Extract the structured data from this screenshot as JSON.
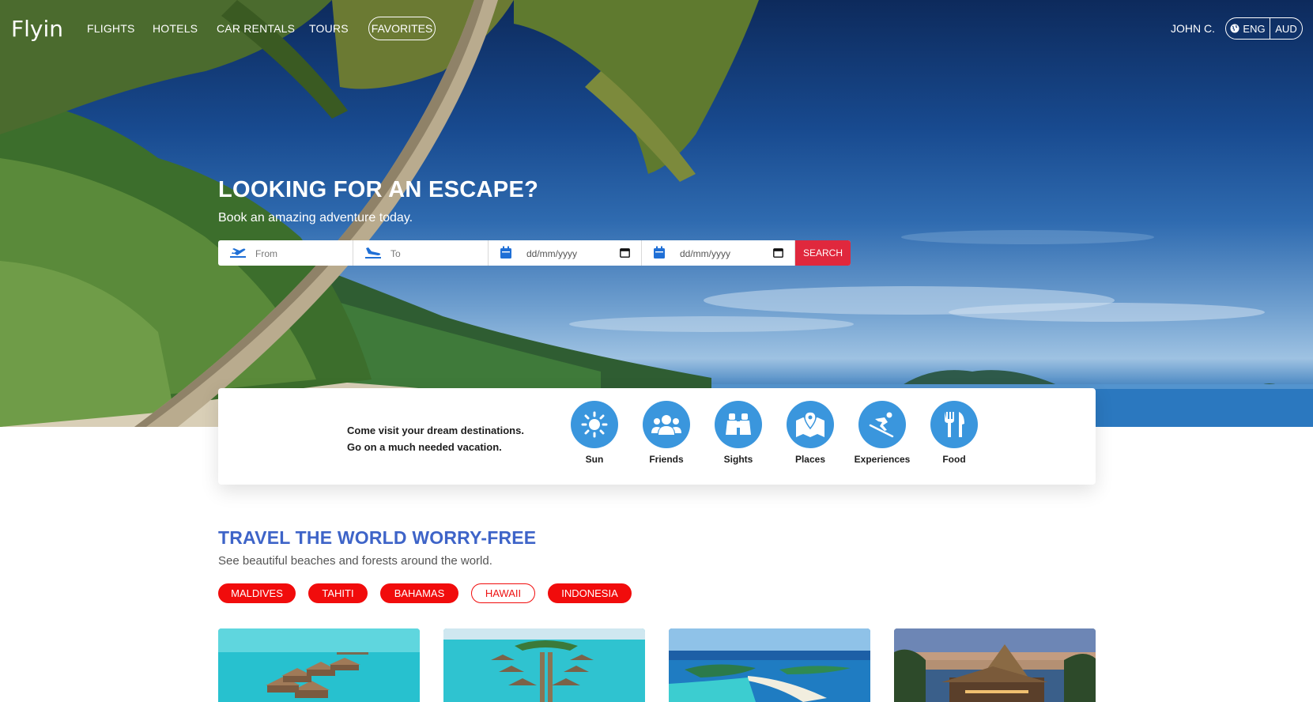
{
  "app": {
    "logo": "Flyin"
  },
  "nav": {
    "links": [
      "FLIGHTS",
      "HOTELS",
      "CAR RENTALS",
      "TOURS"
    ],
    "favorites": "FAVORITES",
    "user": "JOHN C.",
    "language": "ENG",
    "currency": "AUD"
  },
  "hero": {
    "headline": "LOOKING FOR AN ESCAPE?",
    "subline": "Book an amazing adventure today."
  },
  "search": {
    "from_placeholder": "From",
    "to_placeholder": "To",
    "date1_placeholder": "dd/mm/yyyy",
    "date2_placeholder": "dd/mm/yyyy",
    "button": "SEARCH"
  },
  "categories": {
    "line1": "Come visit your dream destinations.",
    "line2": "Go on a much needed vacation.",
    "items": [
      {
        "label": "Sun",
        "icon": "sun-icon"
      },
      {
        "label": "Friends",
        "icon": "friends-icon"
      },
      {
        "label": "Sights",
        "icon": "binoculars-icon"
      },
      {
        "label": "Places",
        "icon": "map-pin-icon"
      },
      {
        "label": "Experiences",
        "icon": "skiing-icon"
      },
      {
        "label": "Food",
        "icon": "utensils-icon"
      }
    ]
  },
  "section": {
    "title": "TRAVEL THE WORLD WORRY-FREE",
    "subtitle": "See beautiful beaches and forests around the world.",
    "filters": [
      {
        "label": "MALDIVES",
        "active": false
      },
      {
        "label": "TAHITI",
        "active": false
      },
      {
        "label": "BAHAMAS",
        "active": false
      },
      {
        "label": "HAWAII",
        "active": true
      },
      {
        "label": "INDONESIA",
        "active": false
      }
    ]
  },
  "colors": {
    "accent_red": "#e0283d",
    "pill_red": "#f10c0c",
    "category_blue": "#3a96dd",
    "title_blue": "#3e64c8"
  }
}
